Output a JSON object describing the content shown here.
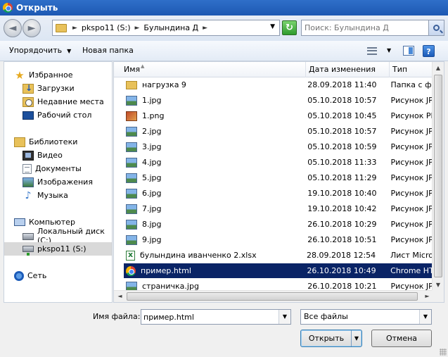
{
  "window": {
    "title": "Открыть"
  },
  "nav": {
    "back_symbol": "◄",
    "forward_symbol": "►",
    "breadcrumb": [
      "pkspo11 (S:)",
      "Булындина Д"
    ],
    "refresh_symbol": "↻",
    "search_placeholder": "Поиск: Булындина Д"
  },
  "toolbar": {
    "organize_label": "Упорядочить",
    "new_folder_label": "Новая папка"
  },
  "sidebar": {
    "items": [
      {
        "label": "Избранное",
        "icon": "star-icon",
        "level": "top"
      },
      {
        "label": "Загрузки",
        "icon": "downloads-icon",
        "level": "sub"
      },
      {
        "label": "Недавние места",
        "icon": "recent-places-icon",
        "level": "sub"
      },
      {
        "label": "Рабочий стол",
        "icon": "desktop-icon",
        "level": "sub"
      },
      {
        "label": "Библиотеки",
        "icon": "libraries-icon",
        "level": "top"
      },
      {
        "label": "Видео",
        "icon": "video-icon",
        "level": "sub"
      },
      {
        "label": "Документы",
        "icon": "documents-icon",
        "level": "sub"
      },
      {
        "label": "Изображения",
        "icon": "images-icon",
        "level": "sub"
      },
      {
        "label": "Музыка",
        "icon": "music-icon",
        "level": "sub"
      },
      {
        "label": "Компьютер",
        "icon": "computer-icon",
        "level": "top"
      },
      {
        "label": "Локальный диск (C:)",
        "icon": "local-disk-icon",
        "level": "sub"
      },
      {
        "label": "pkspo11 (S:)",
        "icon": "network-drive-icon",
        "level": "sub",
        "selected": true
      },
      {
        "label": "Сеть",
        "icon": "network-icon",
        "level": "top"
      }
    ]
  },
  "filelist": {
    "columns": {
      "name": "Имя",
      "date": "Дата изменения",
      "type": "Тип"
    },
    "rows": [
      {
        "name": "нагрузка 9",
        "date": "28.09.2018 11:40",
        "type": "Папка с файлами",
        "icon": "folder"
      },
      {
        "name": "1.jpg",
        "date": "05.10.2018 10:57",
        "type": "Рисунок JPEG",
        "icon": "jpg"
      },
      {
        "name": "1.png",
        "date": "05.10.2018 10:45",
        "type": "Рисунок PNG",
        "icon": "png"
      },
      {
        "name": "2.jpg",
        "date": "05.10.2018 10:57",
        "type": "Рисунок JPEG",
        "icon": "jpg"
      },
      {
        "name": "3.jpg",
        "date": "05.10.2018 10:59",
        "type": "Рисунок JPEG",
        "icon": "jpg"
      },
      {
        "name": "4.jpg",
        "date": "05.10.2018 11:33",
        "type": "Рисунок JPEG",
        "icon": "jpg"
      },
      {
        "name": "5.jpg",
        "date": "05.10.2018 11:29",
        "type": "Рисунок JPEG",
        "icon": "jpg"
      },
      {
        "name": "6.jpg",
        "date": "19.10.2018 10:40",
        "type": "Рисунок JPEG",
        "icon": "jpg"
      },
      {
        "name": "7.jpg",
        "date": "19.10.2018 10:42",
        "type": "Рисунок JPEG",
        "icon": "jpg"
      },
      {
        "name": "8.jpg",
        "date": "26.10.2018 10:29",
        "type": "Рисунок JPEG",
        "icon": "jpg"
      },
      {
        "name": "9.jpg",
        "date": "26.10.2018 10:51",
        "type": "Рисунок JPEG",
        "icon": "jpg"
      },
      {
        "name": "булындина иванченко 2.xlsx",
        "date": "28.09.2018 12:54",
        "type": "Лист Microsoft Excel",
        "icon": "xlsx"
      },
      {
        "name": "пример.html",
        "date": "26.10.2018 10:49",
        "type": "Chrome HTML Document",
        "icon": "html",
        "selected": true
      },
      {
        "name": "страничка.jpg",
        "date": "26.10.2018 10:21",
        "type": "Рисунок JPEG",
        "icon": "jpg"
      }
    ]
  },
  "footer": {
    "filename_label": "Имя файла:",
    "filename_value": "пример.html",
    "filetype_value": "Все файлы",
    "open_label": "Открыть",
    "cancel_label": "Отмена"
  },
  "colors": {
    "title_bar": "#1d58b3",
    "selection": "#0a2466",
    "nav_selection": "#d9d9d9"
  }
}
